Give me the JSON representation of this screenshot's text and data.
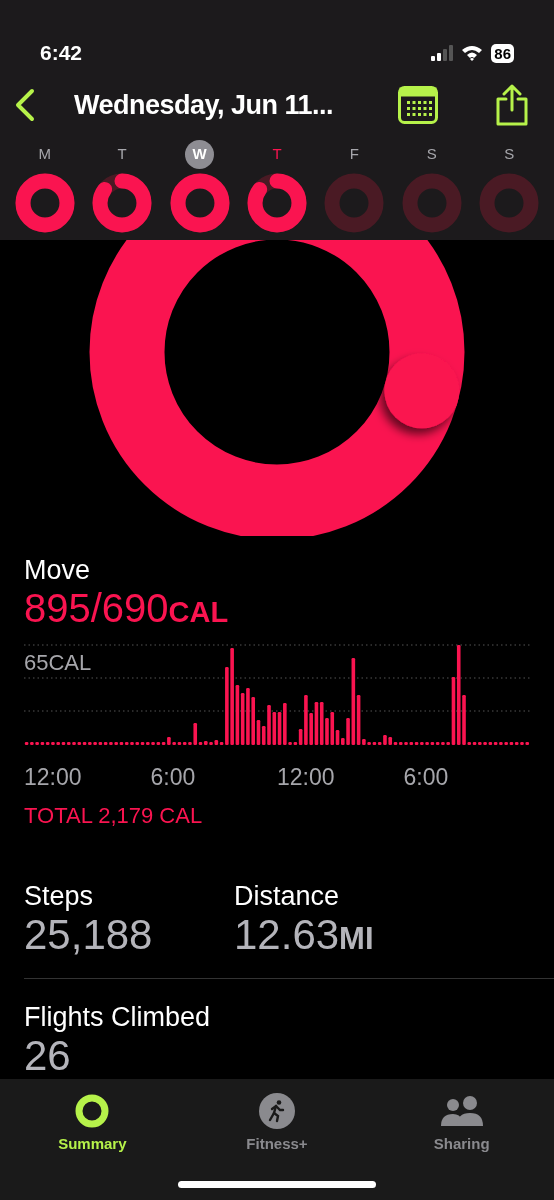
{
  "status_bar": {
    "time": "6:42",
    "battery": "86"
  },
  "header": {
    "title": "Wednesday, Jun 11..."
  },
  "week": [
    {
      "day": "M",
      "selected": false,
      "today": false,
      "kind": "closed"
    },
    {
      "day": "T",
      "selected": false,
      "today": false,
      "kind": "partial"
    },
    {
      "day": "W",
      "selected": true,
      "today": false,
      "kind": "closed"
    },
    {
      "day": "T",
      "selected": false,
      "today": true,
      "kind": "partial"
    },
    {
      "day": "F",
      "selected": false,
      "today": false,
      "kind": "empty"
    },
    {
      "day": "S",
      "selected": false,
      "today": false,
      "kind": "empty"
    },
    {
      "day": "S",
      "selected": false,
      "today": false,
      "kind": "empty"
    }
  ],
  "move": {
    "label": "Move",
    "value": "895/690",
    "unit": "CAL",
    "chart_max_label": "65CAL",
    "x_labels": [
      "12:00",
      "6:00",
      "12:00",
      "6:00"
    ],
    "total": "TOTAL 2,179 CAL"
  },
  "stats": [
    {
      "label": "Steps",
      "value": "25,188"
    },
    {
      "label": "Distance",
      "value": "12.63",
      "unit": "MI"
    }
  ],
  "flights": {
    "label": "Flights Climbed",
    "value": "26"
  },
  "tabs": [
    {
      "label": "Summary",
      "kind": "rings",
      "selected": true
    },
    {
      "label": "Fitness+",
      "kind": "runner",
      "selected": false
    },
    {
      "label": "Sharing",
      "kind": "people",
      "selected": false
    }
  ]
}
